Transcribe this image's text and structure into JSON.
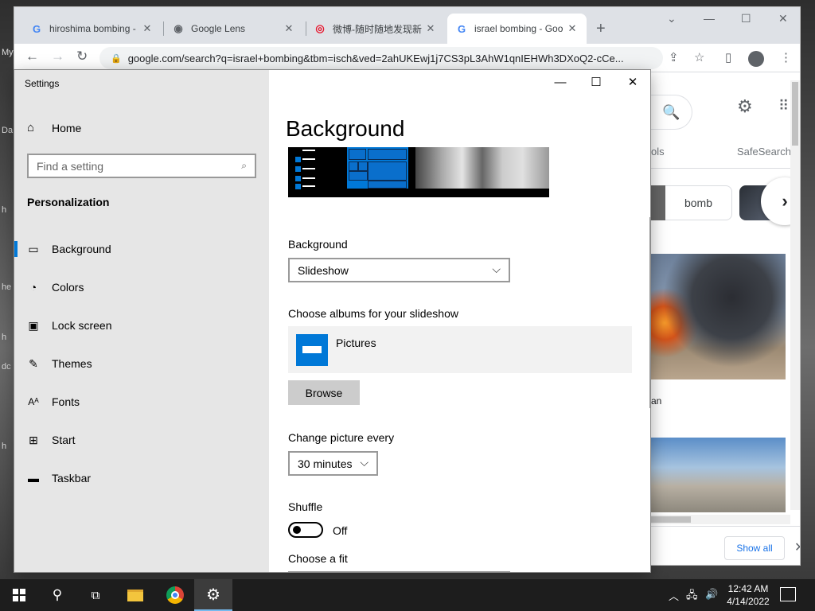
{
  "desktop": {
    "fragments": [
      "My",
      "Da",
      "h",
      "he",
      "h",
      "dc",
      "h"
    ]
  },
  "browser": {
    "tabs": [
      {
        "title": "hiroshima bombing -",
        "favicon": "google-icon"
      },
      {
        "title": "Google Lens",
        "favicon": "globe-icon"
      },
      {
        "title": "微博-随时随地发现新",
        "favicon": "weibo-icon"
      },
      {
        "title": "israel bombing - Goo",
        "favicon": "google-icon",
        "active": true
      }
    ],
    "new_tab": "+",
    "url": "google.com/search?q=israel+bombing&tbm=isch&ved=2ahUKEwj1j7CS3pL3AhW1qnIEHWh3DXoQ2-cCe...",
    "page": {
      "tools_fragment": "ols",
      "safesearch": "SafeSearch",
      "chip_label": "bomb",
      "caption_fragment": "an",
      "show_all": "Show all"
    }
  },
  "settings": {
    "app_title": "Settings",
    "home": "Home",
    "search_placeholder": "Find a setting",
    "section": "Personalization",
    "nav": [
      {
        "label": "Background",
        "icon": "picture-icon",
        "active": true
      },
      {
        "label": "Colors",
        "icon": "palette-icon"
      },
      {
        "label": "Lock screen",
        "icon": "lock-screen-icon"
      },
      {
        "label": "Themes",
        "icon": "themes-icon"
      },
      {
        "label": "Fonts",
        "icon": "fonts-icon"
      },
      {
        "label": "Start",
        "icon": "start-icon"
      },
      {
        "label": "Taskbar",
        "icon": "taskbar-icon"
      }
    ],
    "page_title": "Background",
    "background_label": "Background",
    "background_value": "Slideshow",
    "albums_label": "Choose albums for your slideshow",
    "album_name": "Pictures",
    "browse": "Browse",
    "change_label": "Change picture every",
    "change_value": "30 minutes",
    "shuffle_label": "Shuffle",
    "shuffle_state": "Off",
    "fit_label": "Choose a fit"
  },
  "taskbar": {
    "time": "12:42 AM",
    "date": "4/14/2022"
  },
  "colors": {
    "accent": "#0078d7",
    "chrome_tabstrip": "#dee1e6",
    "settings_sidebar": "#e6e6e6",
    "taskbar": "#1d1d1d"
  }
}
